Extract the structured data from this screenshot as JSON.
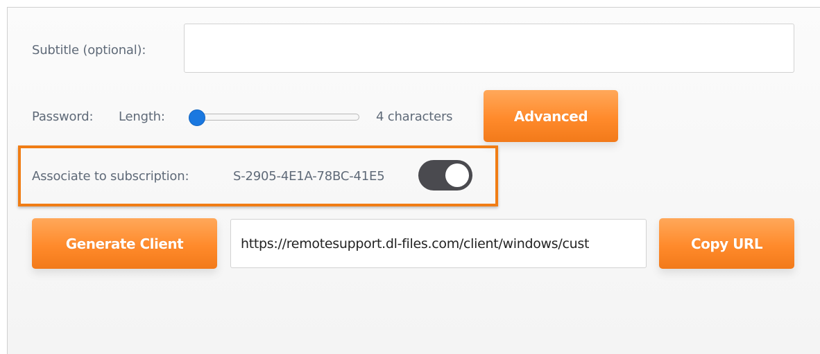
{
  "subtitle": {
    "label": "Subtitle (optional):",
    "value": "",
    "placeholder": ""
  },
  "password": {
    "label": "Password:",
    "length_label": "Length:",
    "length_text": "4 characters",
    "slider_fraction": 0.0,
    "advanced_label": "Advanced"
  },
  "subscription": {
    "label": "Associate to subscription:",
    "id": "S-2905-4E1A-78BC-41E5",
    "enabled": true
  },
  "generate": {
    "button_label": "Generate Client",
    "url": "https://remotesupport.dl-files.com/client/windows/cust",
    "copy_label": "Copy URL"
  },
  "colors": {
    "accent": "#ff8a2b",
    "highlight_border": "#f07d15",
    "toggle_on": "#4a4a4f",
    "slider_thumb": "#1a78e0",
    "label_text": "#5f6a78"
  }
}
